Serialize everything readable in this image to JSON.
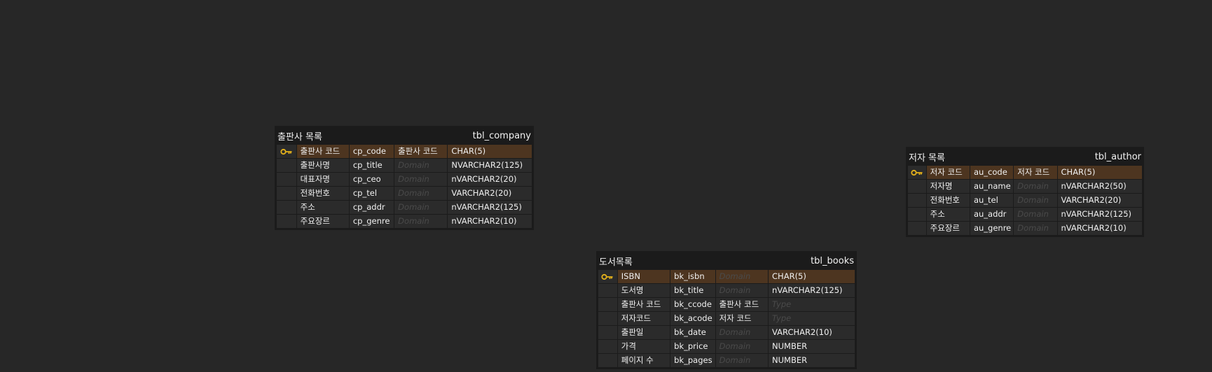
{
  "colors": {
    "canvas": "#272727",
    "table_bg": "#1b1b1b",
    "row_bg": "#2b2b2b",
    "pk_row_bg": "#4d3520",
    "key_icon": "#e5b21b",
    "placeholder_text": "#4a4a4a"
  },
  "tables": {
    "company": {
      "logical_name": "출판사 목록",
      "physical_name": "tbl_company",
      "rows": [
        {
          "pk": true,
          "logical": "출판사 코드",
          "physical": "cp_code",
          "domain": "출판사 코드",
          "domain_placeholder": false,
          "type": "CHAR(5)",
          "type_placeholder": false
        },
        {
          "pk": false,
          "logical": "출판사명",
          "physical": "cp_title",
          "domain": "Domain",
          "domain_placeholder": true,
          "type": "NVARCHAR2(125)",
          "type_placeholder": false
        },
        {
          "pk": false,
          "logical": "대표자명",
          "physical": "cp_ceo",
          "domain": "Domain",
          "domain_placeholder": true,
          "type": "nVARCHAR2(20)",
          "type_placeholder": false
        },
        {
          "pk": false,
          "logical": "전화번호",
          "physical": "cp_tel",
          "domain": "Domain",
          "domain_placeholder": true,
          "type": "VARCHAR2(20)",
          "type_placeholder": false
        },
        {
          "pk": false,
          "logical": "주소",
          "physical": "cp_addr",
          "domain": "Domain",
          "domain_placeholder": true,
          "type": "nVARCHAR2(125)",
          "type_placeholder": false
        },
        {
          "pk": false,
          "logical": "주요장르",
          "physical": "cp_genre",
          "domain": "Domain",
          "domain_placeholder": true,
          "type": "nVARCHAR2(10)",
          "type_placeholder": false
        }
      ]
    },
    "author": {
      "logical_name": "저자 목록",
      "physical_name": "tbl_author",
      "rows": [
        {
          "pk": true,
          "logical": "저자 코드",
          "physical": "au_code",
          "domain": "저자 코드",
          "domain_placeholder": false,
          "type": "CHAR(5)",
          "type_placeholder": false
        },
        {
          "pk": false,
          "logical": "저자명",
          "physical": "au_name",
          "domain": "Domain",
          "domain_placeholder": true,
          "type": "nVARCHAR2(50)",
          "type_placeholder": false
        },
        {
          "pk": false,
          "logical": "전화번호",
          "physical": "au_tel",
          "domain": "Domain",
          "domain_placeholder": true,
          "type": "VARCHAR2(20)",
          "type_placeholder": false
        },
        {
          "pk": false,
          "logical": "주소",
          "physical": "au_addr",
          "domain": "Domain",
          "domain_placeholder": true,
          "type": "nVARCHAR2(125)",
          "type_placeholder": false
        },
        {
          "pk": false,
          "logical": "주요장르",
          "physical": "au_genre",
          "domain": "Domain",
          "domain_placeholder": true,
          "type": "nVARCHAR2(10)",
          "type_placeholder": false
        }
      ]
    },
    "books": {
      "logical_name": "도서목록",
      "physical_name": "tbl_books",
      "rows": [
        {
          "pk": true,
          "logical": "ISBN",
          "physical": "bk_isbn",
          "domain": "Domain",
          "domain_placeholder": true,
          "type": "CHAR(5)",
          "type_placeholder": false
        },
        {
          "pk": false,
          "logical": "도서명",
          "physical": "bk_title",
          "domain": "Domain",
          "domain_placeholder": true,
          "type": "nVARCHAR2(125)",
          "type_placeholder": false
        },
        {
          "pk": false,
          "logical": "출판사 코드",
          "physical": "bk_ccode",
          "domain": "출판사 코드",
          "domain_placeholder": false,
          "type": "Type",
          "type_placeholder": true
        },
        {
          "pk": false,
          "logical": "저자코드",
          "physical": "bk_acode",
          "domain": "저자 코드",
          "domain_placeholder": false,
          "type": "Type",
          "type_placeholder": true
        },
        {
          "pk": false,
          "logical": "출판일",
          "physical": "bk_date",
          "domain": "Domain",
          "domain_placeholder": true,
          "type": "VARCHAR2(10)",
          "type_placeholder": false
        },
        {
          "pk": false,
          "logical": "가격",
          "physical": "bk_price",
          "domain": "Domain",
          "domain_placeholder": true,
          "type": "NUMBER",
          "type_placeholder": false
        },
        {
          "pk": false,
          "logical": "페이지 수",
          "physical": "bk_pages",
          "domain": "Domain",
          "domain_placeholder": true,
          "type": "NUMBER",
          "type_placeholder": false
        }
      ]
    }
  }
}
